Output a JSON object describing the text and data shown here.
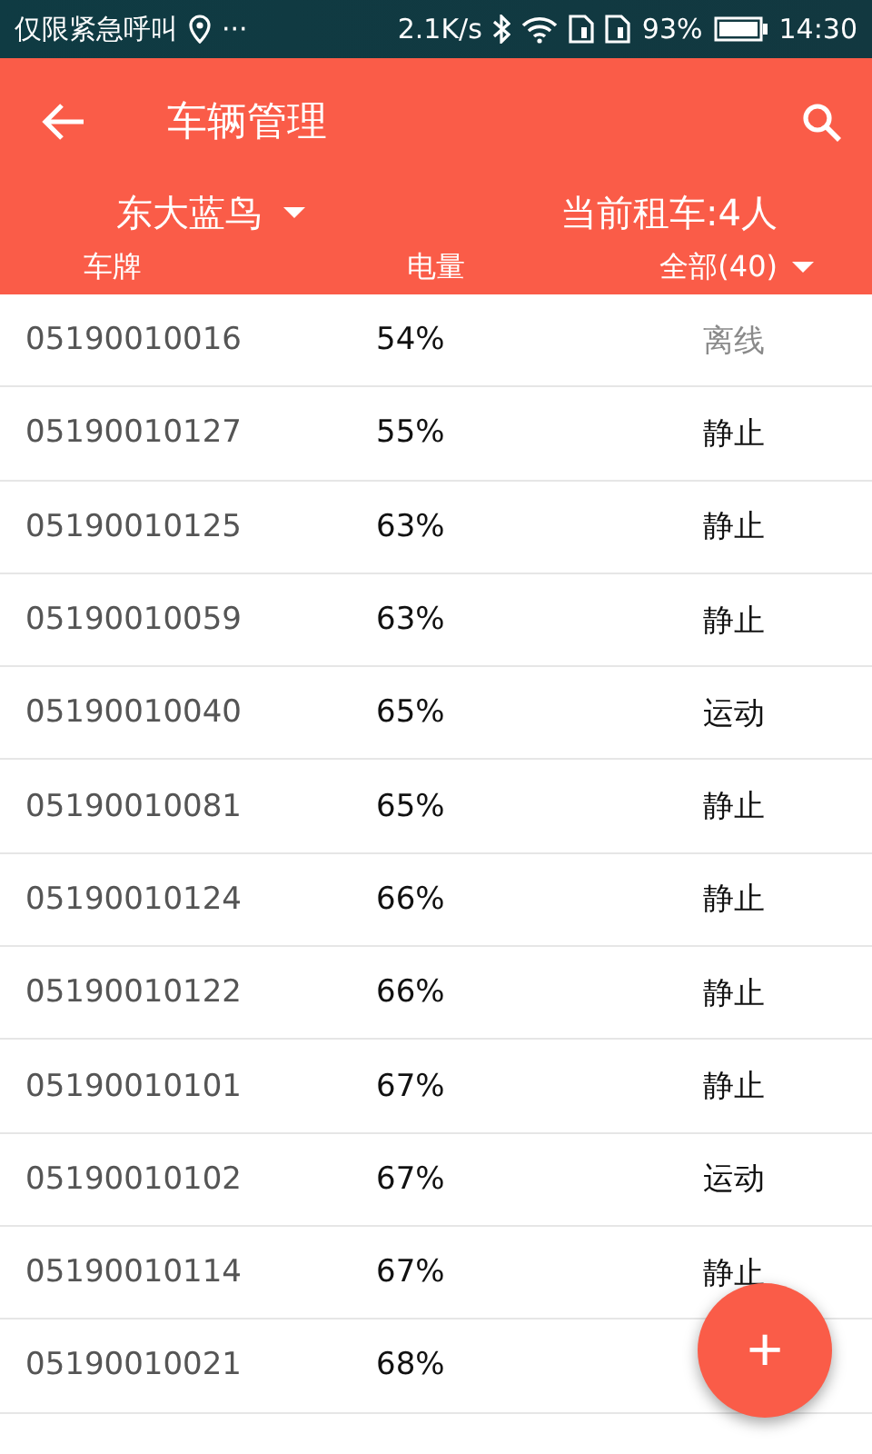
{
  "status_bar": {
    "carrier": "仅限紧急呼叫",
    "more": "···",
    "speed": "2.1K/s",
    "battery": "93%",
    "time": "14:30"
  },
  "app_bar": {
    "title": "车辆管理"
  },
  "filter": {
    "company": "东大蓝鸟",
    "renting": "当前租车:4人"
  },
  "columns": {
    "plate": "车牌",
    "battery": "电量",
    "status": "全部(40)"
  },
  "rows": [
    {
      "plate": "05190010016",
      "battery": "54%",
      "status": "离线",
      "offline": true
    },
    {
      "plate": "05190010127",
      "battery": "55%",
      "status": "静止",
      "offline": false
    },
    {
      "plate": "05190010125",
      "battery": "63%",
      "status": "静止",
      "offline": false
    },
    {
      "plate": "05190010059",
      "battery": "63%",
      "status": "静止",
      "offline": false
    },
    {
      "plate": "05190010040",
      "battery": "65%",
      "status": "运动",
      "offline": false
    },
    {
      "plate": "05190010081",
      "battery": "65%",
      "status": "静止",
      "offline": false
    },
    {
      "plate": "05190010124",
      "battery": "66%",
      "status": "静止",
      "offline": false
    },
    {
      "plate": "05190010122",
      "battery": "66%",
      "status": "静止",
      "offline": false
    },
    {
      "plate": "05190010101",
      "battery": "67%",
      "status": "静止",
      "offline": false
    },
    {
      "plate": "05190010102",
      "battery": "67%",
      "status": "运动",
      "offline": false
    },
    {
      "plate": "05190010114",
      "battery": "67%",
      "status": "静止",
      "offline": false
    },
    {
      "plate": "05190010021",
      "battery": "68%"
    }
  ],
  "fab": {
    "label": "+"
  }
}
